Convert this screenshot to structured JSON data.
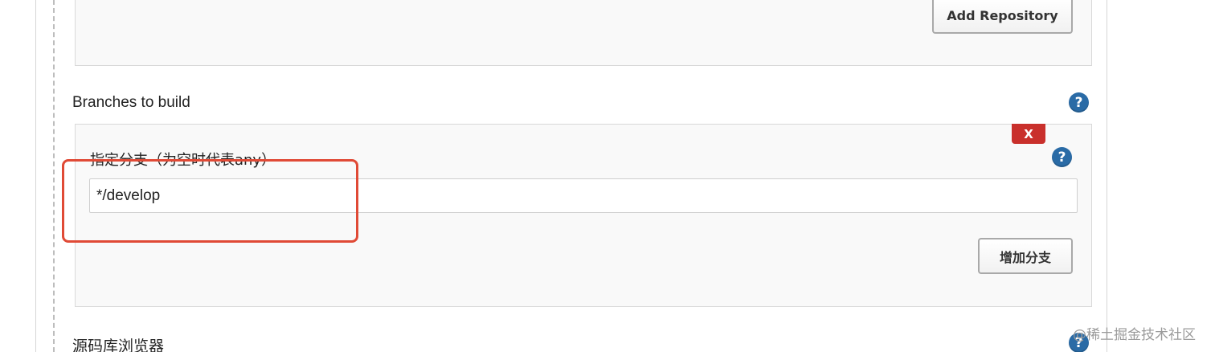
{
  "repositories": {
    "add_repository_label": "Add Repository"
  },
  "branches": {
    "section_label": "Branches to build",
    "delete_label": "X",
    "branch_specifier_label": "指定分支（为空时代表any）",
    "branch_specifier_value": "*/develop",
    "add_branch_label": "增加分支"
  },
  "repository_browser": {
    "section_label": "源码库浏览器"
  },
  "help_label": "?",
  "watermark": "@稀土掘金技术社区",
  "colors": {
    "help_icon": "#2a6ba6",
    "delete_button": "#c9302c",
    "highlight": "#e04a36"
  },
  "icons": {
    "help": "help-icon",
    "delete": "close-icon"
  }
}
